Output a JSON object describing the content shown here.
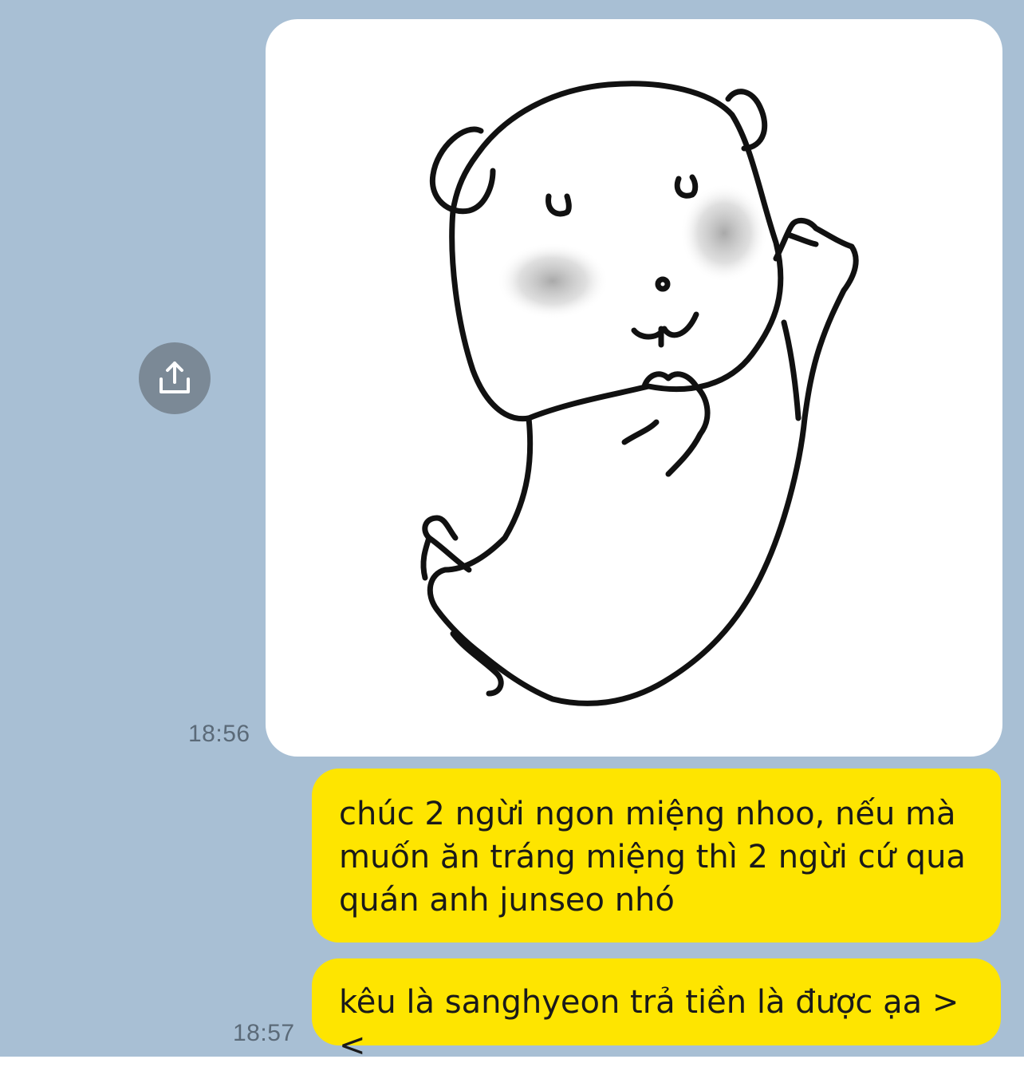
{
  "chat": {
    "messages": [
      {
        "type": "sticker",
        "sticker_name": "white-guinea-pig-waving-sticker",
        "time": "18:56"
      },
      {
        "type": "text",
        "text": "chúc 2 ngừi ngon miệng nhoo, nếu mà muốn ăn tráng miệng thì 2 ngừi cứ qua quán anh junseo nhó"
      },
      {
        "type": "text",
        "text": "kêu là sanghyeon trả tiền là được ạa ><",
        "time": "18:57"
      }
    ],
    "share_icon": "share-upload-icon"
  },
  "colors": {
    "background": "#a8bfd4",
    "sent_bubble": "#fee500",
    "share_button": "#7b8996",
    "timestamp": "#5b6a78"
  }
}
